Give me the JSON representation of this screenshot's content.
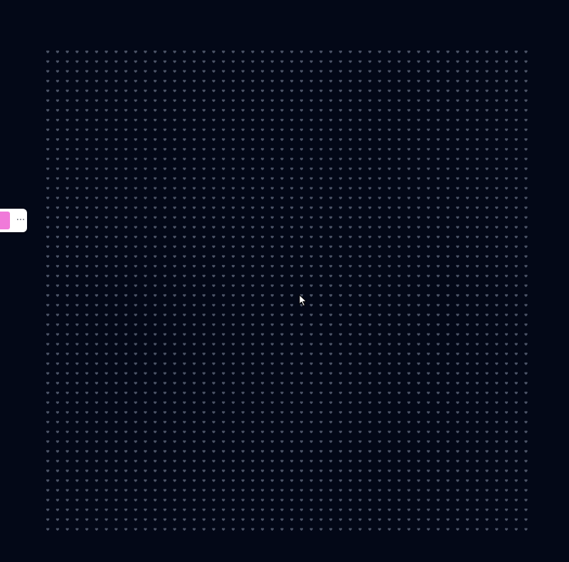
{
  "canvas": {
    "background": "#030817",
    "pattern_icon": "heart-icon",
    "pattern_color": "#4b5366",
    "pattern_rows": 50,
    "pattern_cols": 50
  },
  "toolbar": {
    "swatch_color": "#f07ad9",
    "more_label": "···",
    "more_icon": "ellipsis-icon"
  },
  "cursor": {
    "icon": "mouse-pointer-icon"
  }
}
